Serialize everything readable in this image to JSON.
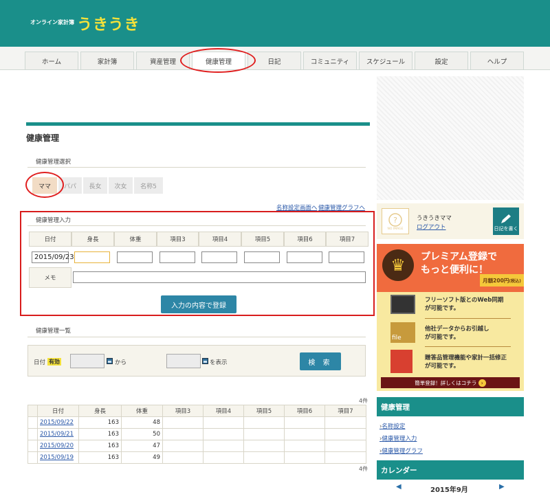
{
  "header": {
    "tagline": "オンライン家計簿",
    "logo": "うきうき",
    "brand_color": "#1a8f8a"
  },
  "nav": {
    "tabs": [
      {
        "label": "ホーム"
      },
      {
        "label": "家計簿"
      },
      {
        "label": "資産管理"
      },
      {
        "label": "健康管理",
        "active": true
      },
      {
        "label": "日記"
      },
      {
        "label": "コミュニティ"
      },
      {
        "label": "スケジュール"
      },
      {
        "label": "設定"
      },
      {
        "label": "ヘルプ"
      }
    ]
  },
  "page": {
    "title": "健康管理"
  },
  "selector": {
    "label": "健康管理選択",
    "people": [
      "ママ",
      "パパ",
      "長女",
      "次女",
      "名称5"
    ],
    "selected": "ママ"
  },
  "links": {
    "name_settings": "名称設定画面へ",
    "graph": "健康管理グラフへ"
  },
  "input": {
    "label": "健康管理入力",
    "headers": [
      "日付",
      "身長",
      "体重",
      "項目3",
      "項目4",
      "項目5",
      "項目6",
      "項目7"
    ],
    "date_value": "2015/09/23",
    "memo_label": "メモ",
    "submit": "入力の内容で登録"
  },
  "search": {
    "label": "健康管理一覧",
    "date_label": "日付",
    "valid_badge": "有効",
    "from": "から",
    "display": "を表示",
    "button": "検 索"
  },
  "list": {
    "count": "4件",
    "headers": [
      "日付",
      "身長",
      "体重",
      "項目3",
      "項目4",
      "項目5",
      "項目6",
      "項目7"
    ],
    "rows": [
      {
        "date": "2015/09/22",
        "height": "163",
        "weight": "48"
      },
      {
        "date": "2015/09/21",
        "height": "163",
        "weight": "50"
      },
      {
        "date": "2015/09/20",
        "height": "163",
        "weight": "47"
      },
      {
        "date": "2015/09/19",
        "height": "163",
        "weight": "49"
      }
    ]
  },
  "user": {
    "name": "うきうきママ",
    "logout": "ログアウト",
    "no_image": "NO IMAGE",
    "diary_button": "日記を書く"
  },
  "premium": {
    "title_line1": "プレミアム登録で",
    "title_line2": "もっと便利に！",
    "price": "月額200円",
    "price_note": "(税込)",
    "features": [
      {
        "line1": "フリーソフト版とのWeb同期",
        "line2": "が可能です。",
        "icon": "monitor-icon"
      },
      {
        "line1": "他社データからお引越し",
        "line2": "が可能です。",
        "icon": "file-folder-icon"
      },
      {
        "line1": "贈答品管理機能や家計一括修正",
        "line2": "が可能です。",
        "icon": "calculator-icon"
      }
    ],
    "cta": "簡単登録！詳しくはコチラ"
  },
  "sidebar": {
    "health_title": "健康管理",
    "health_links": [
      "名称設定",
      "健康管理入力",
      "健康管理グラフ"
    ],
    "calendar_title": "カレンダー",
    "calendar_month": "2015年9月"
  }
}
